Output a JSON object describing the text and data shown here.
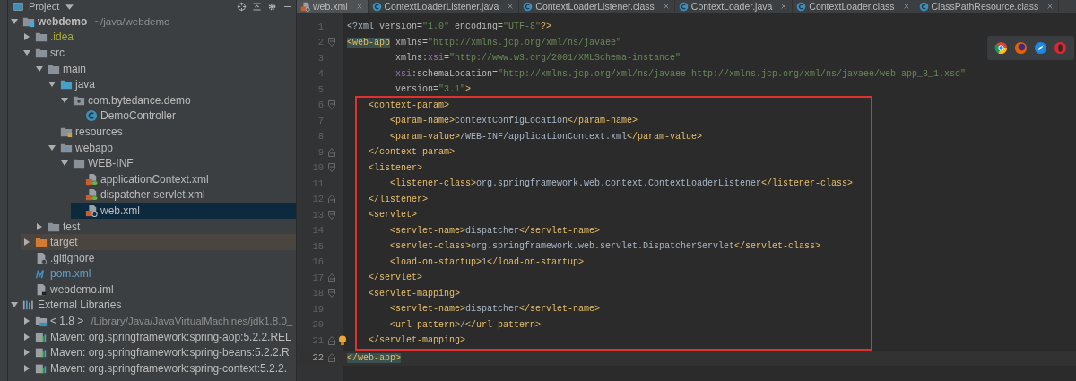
{
  "sidebar": {
    "title": "Project",
    "tree": [
      {
        "label": "webdemo",
        "hint": "~/java/webdemo",
        "kind": "module",
        "bold": true,
        "expanded": true,
        "selected": false,
        "excluded": false,
        "color": "#bbbbbb",
        "children": [
          {
            "label": ".idea",
            "kind": "folder",
            "expanded": false,
            "selected": false,
            "excluded": false,
            "color": "#a8a83a"
          },
          {
            "label": "src",
            "kind": "folder",
            "expanded": true,
            "selected": false,
            "excluded": false,
            "color": "#bbbbbb",
            "children": [
              {
                "label": "main",
                "kind": "folder",
                "expanded": true,
                "selected": false,
                "excluded": false,
                "color": "#bbbbbb",
                "children": [
                  {
                    "label": "java",
                    "kind": "source-folder",
                    "expanded": true,
                    "selected": false,
                    "excluded": false,
                    "color": "#bbbbbb",
                    "children": [
                      {
                        "label": "com.bytedance.demo",
                        "kind": "package",
                        "expanded": true,
                        "selected": false,
                        "excluded": false,
                        "color": "#bbbbbb",
                        "children": [
                          {
                            "label": "DemoController",
                            "kind": "class",
                            "selected": false,
                            "excluded": false,
                            "color": "#bbbbbb"
                          }
                        ]
                      }
                    ]
                  },
                  {
                    "label": "resources",
                    "kind": "resources",
                    "selected": false,
                    "excluded": false,
                    "color": "#bbbbbb"
                  },
                  {
                    "label": "webapp",
                    "kind": "web-folder",
                    "expanded": true,
                    "selected": false,
                    "excluded": false,
                    "color": "#bbbbbb",
                    "children": [
                      {
                        "label": "WEB-INF",
                        "kind": "folder",
                        "expanded": true,
                        "selected": false,
                        "excluded": false,
                        "color": "#bbbbbb",
                        "children": [
                          {
                            "label": "applicationContext.xml",
                            "kind": "spring-xml",
                            "selected": false,
                            "excluded": false,
                            "color": "#bbbbbb"
                          },
                          {
                            "label": "dispatcher-servlet.xml",
                            "kind": "spring-xml",
                            "selected": false,
                            "excluded": false,
                            "color": "#bbbbbb"
                          },
                          {
                            "label": "web.xml",
                            "kind": "web-xml",
                            "selected": true,
                            "excluded": false,
                            "color": "#bbbbbb"
                          }
                        ]
                      }
                    ]
                  }
                ]
              },
              {
                "label": "test",
                "kind": "folder",
                "expanded": false,
                "selected": false,
                "excluded": false,
                "color": "#bbbbbb"
              }
            ]
          },
          {
            "label": "target",
            "kind": "excluded-folder",
            "expanded": false,
            "selected": false,
            "excluded": true,
            "color": "#bbbbbb"
          },
          {
            "label": ".gitignore",
            "kind": "ignore-file",
            "selected": false,
            "excluded": false,
            "color": "#bbbbbb"
          },
          {
            "label": "pom.xml",
            "kind": "maven",
            "selected": false,
            "excluded": false,
            "color": "#5f9ec9"
          },
          {
            "label": "webdemo.iml",
            "kind": "iml",
            "selected": false,
            "excluded": false,
            "color": "#bbbbbb"
          }
        ]
      },
      {
        "label": "External Libraries",
        "kind": "libraries",
        "expanded": true,
        "selected": false,
        "excluded": false,
        "color": "#bbbbbb",
        "children": [
          {
            "label": "< 1.8 >",
            "hint": "/Library/Java/JavaVirtualMachines/jdk1.8.0_",
            "kind": "jdk",
            "expanded": false,
            "selected": false,
            "excluded": false,
            "color": "#bbbbbb"
          },
          {
            "label": "Maven: org.springframework:spring-aop:5.2.2.REL",
            "kind": "library",
            "expanded": false,
            "selected": false,
            "excluded": false,
            "color": "#bbbbbb"
          },
          {
            "label": "Maven: org.springframework:spring-beans:5.2.2.R",
            "kind": "library",
            "expanded": false,
            "selected": false,
            "excluded": false,
            "color": "#bbbbbb"
          },
          {
            "label": "Maven: org.springframework:spring-context:5.2.2.",
            "kind": "library",
            "expanded": false,
            "selected": false,
            "excluded": false,
            "color": "#bbbbbb"
          }
        ]
      }
    ]
  },
  "tabs": [
    {
      "label": "web.xml",
      "kind": "web-xml",
      "selected": true
    },
    {
      "label": "ContextLoaderListener.java",
      "kind": "class",
      "selected": false
    },
    {
      "label": "ContextLoaderListener.class",
      "kind": "class",
      "selected": false
    },
    {
      "label": "ContextLoader.java",
      "kind": "class",
      "selected": false
    },
    {
      "label": "ContextLoader.class",
      "kind": "class",
      "selected": false
    },
    {
      "label": "ClassPathResource.class",
      "kind": "class",
      "selected": false
    }
  ],
  "editor": {
    "lines": [
      {
        "number": "1",
        "boxed": false,
        "current": false,
        "kind": "plain",
        "bulb": false,
        "tokens": [
          {
            "kind": "text",
            "text": "<?xml "
          },
          {
            "kind": "attr",
            "text": "version="
          },
          {
            "kind": "value",
            "text": "\"1.0\""
          },
          {
            "kind": "attr",
            "text": " encoding="
          },
          {
            "kind": "value",
            "text": "\"UTF-8\""
          },
          {
            "kind": "tag",
            "text": "?>"
          }
        ]
      },
      {
        "number": "2",
        "boxed": false,
        "current": false,
        "kind": "fold-start",
        "bulb": false,
        "tokens": [
          {
            "kind": "tag",
            "text": "<web-app",
            "matched": true
          },
          {
            "kind": "attr",
            "text": " xmlns="
          },
          {
            "kind": "value",
            "text": "\"http://xmlns.jcp.org/xml/ns/javaee\""
          }
        ]
      },
      {
        "number": "3",
        "boxed": false,
        "current": false,
        "kind": "plain",
        "bulb": false,
        "tokens": [
          {
            "kind": "attr",
            "text": "         xmlns:"
          },
          {
            "kind": "ns",
            "text": "xsi"
          },
          {
            "kind": "attr",
            "text": "="
          },
          {
            "kind": "value",
            "text": "\"http://www.w3.org/2001/XMLSchema-instance\""
          }
        ]
      },
      {
        "number": "4",
        "boxed": false,
        "current": false,
        "kind": "plain",
        "bulb": false,
        "tokens": [
          {
            "kind": "ns",
            "text": "         xsi"
          },
          {
            "kind": "attr",
            "text": ":schemaLocation="
          },
          {
            "kind": "value",
            "text": "\"http://xmlns.jcp.org/xml/ns/javaee http://xmlns.jcp.org/xml/ns/javaee/web-app_3_1.xsd\""
          }
        ]
      },
      {
        "number": "5",
        "boxed": false,
        "current": false,
        "kind": "plain",
        "bulb": false,
        "tokens": [
          {
            "kind": "attr",
            "text": "         version="
          },
          {
            "kind": "value",
            "text": "\"3.1\""
          },
          {
            "kind": "tag",
            "text": ">"
          }
        ]
      },
      {
        "number": "6",
        "boxed": true,
        "current": false,
        "kind": "fold-start",
        "bulb": false,
        "tokens": [
          {
            "kind": "tag",
            "text": "    <context-param>"
          }
        ]
      },
      {
        "number": "7",
        "boxed": true,
        "current": false,
        "kind": "plain",
        "bulb": false,
        "tokens": [
          {
            "kind": "tag",
            "text": "        <param-name>"
          },
          {
            "kind": "text",
            "text": "contextConfigLocation"
          },
          {
            "kind": "tag",
            "text": "</param-name>"
          }
        ]
      },
      {
        "number": "8",
        "boxed": true,
        "current": false,
        "kind": "plain",
        "bulb": false,
        "tokens": [
          {
            "kind": "tag",
            "text": "        <param-value>"
          },
          {
            "kind": "text",
            "text": "/WEB-INF/applicationContext.xml"
          },
          {
            "kind": "tag",
            "text": "</param-value>"
          }
        ]
      },
      {
        "number": "9",
        "boxed": true,
        "current": false,
        "kind": "fold-end",
        "bulb": false,
        "tokens": [
          {
            "kind": "tag",
            "text": "    </context-param>"
          }
        ]
      },
      {
        "number": "10",
        "boxed": true,
        "current": false,
        "kind": "fold-start",
        "bulb": false,
        "tokens": [
          {
            "kind": "tag",
            "text": "    <listener>"
          }
        ]
      },
      {
        "number": "11",
        "boxed": true,
        "current": false,
        "kind": "plain",
        "bulb": false,
        "tokens": [
          {
            "kind": "tag",
            "text": "        <listener-class>"
          },
          {
            "kind": "text",
            "text": "org.springframework.web.context.ContextLoaderListener"
          },
          {
            "kind": "tag",
            "text": "</listener-class>"
          }
        ]
      },
      {
        "number": "12",
        "boxed": true,
        "current": false,
        "kind": "fold-end",
        "bulb": false,
        "tokens": [
          {
            "kind": "tag",
            "text": "    </listener>"
          }
        ]
      },
      {
        "number": "13",
        "boxed": true,
        "current": false,
        "kind": "fold-start",
        "bulb": false,
        "tokens": [
          {
            "kind": "tag",
            "text": "    <servlet>"
          }
        ]
      },
      {
        "number": "14",
        "boxed": true,
        "current": false,
        "kind": "plain",
        "bulb": false,
        "tokens": [
          {
            "kind": "tag",
            "text": "        <servlet-name>"
          },
          {
            "kind": "text",
            "text": "dispatcher"
          },
          {
            "kind": "tag",
            "text": "</servlet-name>"
          }
        ]
      },
      {
        "number": "15",
        "boxed": true,
        "current": false,
        "kind": "plain",
        "bulb": false,
        "tokens": [
          {
            "kind": "tag",
            "text": "        <servlet-class>"
          },
          {
            "kind": "text",
            "text": "org.springframework.web.servlet.DispatcherServlet"
          },
          {
            "kind": "tag",
            "text": "</servlet-class>"
          }
        ]
      },
      {
        "number": "16",
        "boxed": true,
        "current": false,
        "kind": "plain",
        "bulb": false,
        "tokens": [
          {
            "kind": "tag",
            "text": "        <load-on-startup>"
          },
          {
            "kind": "text",
            "text": "1"
          },
          {
            "kind": "tag",
            "text": "</load-on-startup>"
          }
        ]
      },
      {
        "number": "17",
        "boxed": true,
        "current": false,
        "kind": "fold-end",
        "bulb": false,
        "tokens": [
          {
            "kind": "tag",
            "text": "    </servlet>"
          }
        ]
      },
      {
        "number": "18",
        "boxed": true,
        "current": false,
        "kind": "fold-start",
        "bulb": false,
        "tokens": [
          {
            "kind": "tag",
            "text": "    <servlet-mapping>"
          }
        ]
      },
      {
        "number": "19",
        "boxed": true,
        "current": false,
        "kind": "plain",
        "bulb": false,
        "tokens": [
          {
            "kind": "tag",
            "text": "        <servlet-name>"
          },
          {
            "kind": "text",
            "text": "dispatcher"
          },
          {
            "kind": "tag",
            "text": "</servlet-name>"
          }
        ]
      },
      {
        "number": "20",
        "boxed": true,
        "current": false,
        "kind": "plain",
        "bulb": false,
        "tokens": [
          {
            "kind": "tag",
            "text": "        <url-pattern>"
          },
          {
            "kind": "text",
            "text": "/"
          },
          {
            "kind": "tag",
            "text": "</url-pattern>"
          }
        ]
      },
      {
        "number": "21",
        "boxed": true,
        "current": false,
        "kind": "fold-end",
        "bulb": true,
        "tokens": [
          {
            "kind": "tag",
            "text": "    </servlet-mapping>"
          }
        ]
      },
      {
        "number": "22",
        "boxed": false,
        "current": true,
        "kind": "fold-end",
        "bulb": false,
        "tokens": [
          {
            "kind": "tag",
            "text": "</web-app>",
            "matched": true
          }
        ]
      }
    ]
  }
}
